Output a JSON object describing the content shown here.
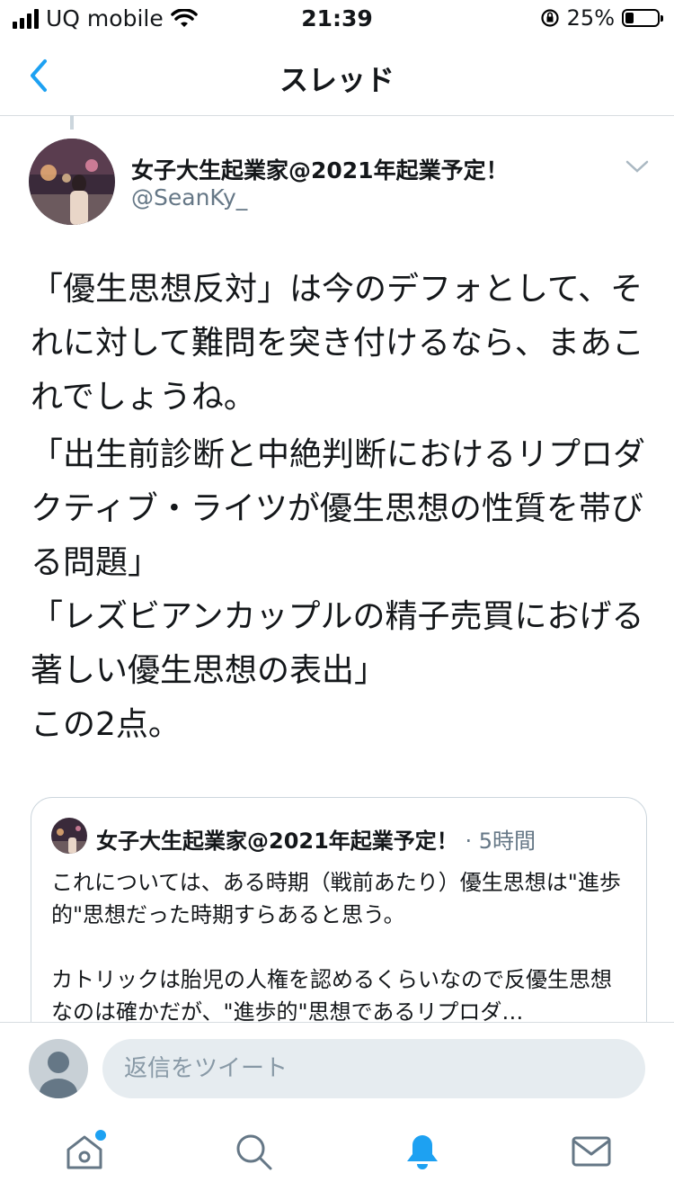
{
  "status_bar": {
    "carrier": "UQ mobile",
    "time": "21:39",
    "battery": "25%",
    "battery_level": 0.25
  },
  "nav": {
    "title": "スレッド"
  },
  "tweet": {
    "display_name": "女子大生起業家@2021年起業予定！",
    "handle": "@SeanKy_",
    "paragraphs": [
      "「優生思想反対」は今のデフォとして、それに対して難問を突き付けるなら、まあこれでしょうね。",
      "「出生前診断と中絶判断におけるリプロダクティブ・ライツが優生思想の性質を帯びる問題」\n「レズビアンカップルの精子売買におげる著しい優生思想の表出」\nこの2点。"
    ]
  },
  "quote": {
    "display_name": "女子大生起業家@2021年起業予定！",
    "time": "· 5時間",
    "paragraphs": [
      "これについては、ある時期（戦前あたり）優生思想は\"進歩的\"思想だった時期すらあると思う。",
      "カトリックは胎児の人権を認めるくらいなので反優生思想なのは確かだが、\"進歩的\"思想であるリプロダ…"
    ]
  },
  "reply": {
    "placeholder": "返信をツイート"
  },
  "tabs": [
    "home-icon",
    "search-icon",
    "notifications-icon",
    "messages-icon"
  ],
  "colors": {
    "accent": "#1da1f2",
    "text": "#14171a",
    "secondary": "#657786"
  }
}
